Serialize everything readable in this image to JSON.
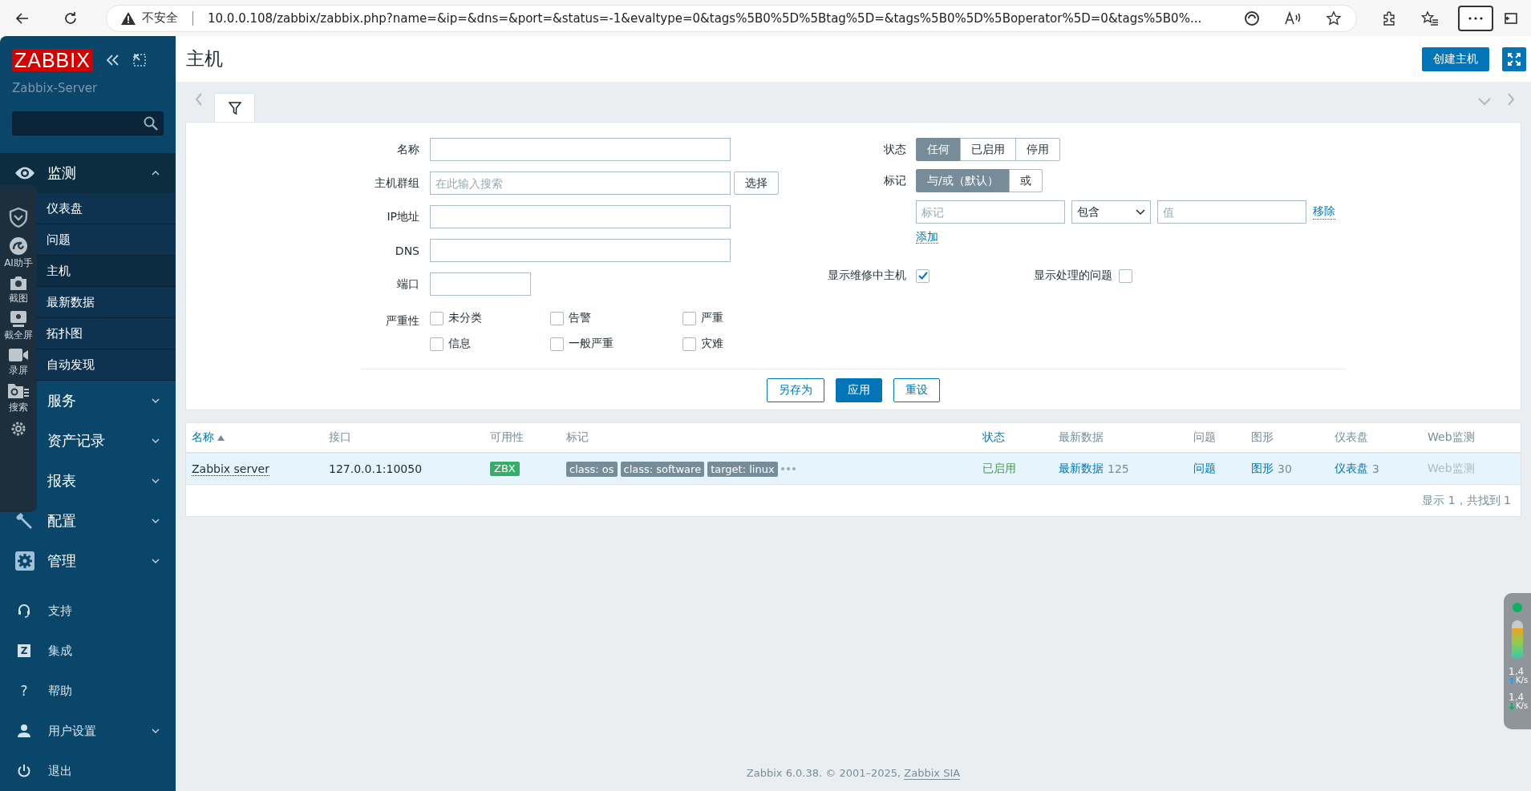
{
  "browser": {
    "security": "不安全",
    "url": "10.0.0.108/zabbix/zabbix.php?name=&ip=&dns=&port=&status=-1&evaltype=0&tags%5B0%5D%5Btag%5D=&tags%5B0%5D%5Boperator%5D=0&tags%5B0%..."
  },
  "sidebar": {
    "logo": "ZABBIX",
    "server_name": "Zabbix-Server",
    "menu": [
      {
        "label": "监测",
        "expanded": true,
        "children": [
          {
            "label": "仪表盘",
            "selected": false
          },
          {
            "label": "问题",
            "selected": false
          },
          {
            "label": "主机",
            "selected": true
          },
          {
            "label": "最新数据",
            "selected": false
          },
          {
            "label": "拓扑图",
            "selected": false
          },
          {
            "label": "自动发现",
            "selected": false
          }
        ]
      },
      {
        "label": "服务",
        "expanded": false
      },
      {
        "label": "资产记录",
        "expanded": false
      },
      {
        "label": "报表",
        "expanded": false
      },
      {
        "label": "配置",
        "expanded": false
      },
      {
        "label": "管理",
        "expanded": false
      }
    ],
    "bottom_menu": [
      {
        "label": "支持",
        "has_submenu": false
      },
      {
        "label": "集成",
        "glyph": "Z",
        "has_submenu": false
      },
      {
        "label": "帮助",
        "glyph": "?",
        "has_submenu": false
      },
      {
        "label": "用户设置",
        "has_submenu": true
      },
      {
        "label": "退出",
        "has_submenu": false
      }
    ]
  },
  "capture_toolbar": {
    "items": [
      {
        "label": "AI助手"
      },
      {
        "label": "截图"
      },
      {
        "label": "截全屏"
      },
      {
        "label": "录屏"
      },
      {
        "label": "搜索"
      }
    ]
  },
  "header": {
    "title": "主机",
    "create_button": "创建主机"
  },
  "filter": {
    "fields": [
      {
        "label": "名称",
        "kind": "text"
      },
      {
        "label": "主机群组",
        "kind": "multiselect",
        "placeholder": "在此输入搜索",
        "button": "选择"
      },
      {
        "label": "IP地址",
        "kind": "text"
      },
      {
        "label": "DNS",
        "kind": "text"
      },
      {
        "label": "端口",
        "kind": "short"
      }
    ],
    "severity": {
      "label": "严重性",
      "options": [
        {
          "label": "未分类",
          "checked": false
        },
        {
          "label": "告警",
          "checked": false
        },
        {
          "label": "严重",
          "checked": false
        },
        {
          "label": "信息",
          "checked": false
        },
        {
          "label": "一般严重",
          "checked": false
        },
        {
          "label": "灾难",
          "checked": false
        }
      ]
    },
    "status": {
      "label": "状态",
      "options": [
        {
          "label": "任何",
          "selected": true
        },
        {
          "label": "已启用",
          "selected": false
        },
        {
          "label": "停用",
          "selected": false
        }
      ]
    },
    "tags": {
      "label": "标记",
      "operators": [
        {
          "label": "与/或（默认）",
          "selected": true
        },
        {
          "label": "或",
          "selected": false
        }
      ],
      "tag_placeholder": "标记",
      "condition": "包含",
      "value_placeholder": "值",
      "remove": "移除",
      "add": "添加"
    },
    "toggles": [
      {
        "label": "显示维修中主机",
        "checked": true
      },
      {
        "label": "显示处理的问题",
        "checked": false
      }
    ],
    "buttons": [
      {
        "label": "另存为",
        "kind": "outline"
      },
      {
        "label": "应用",
        "kind": "primary"
      },
      {
        "label": "重设",
        "kind": "outline"
      }
    ]
  },
  "table": {
    "columns": [
      {
        "label": "名称",
        "sortable": true,
        "sorted": true
      },
      {
        "label": "接口",
        "sortable": false,
        "sorted": false
      },
      {
        "label": "可用性",
        "sortable": false,
        "sorted": false
      },
      {
        "label": "标记",
        "sortable": false,
        "sorted": false
      },
      {
        "label": "状态",
        "sortable": true,
        "sorted": false
      },
      {
        "label": "最新数据",
        "sortable": false,
        "sorted": false
      },
      {
        "label": "问题",
        "sortable": false,
        "sorted": false
      },
      {
        "label": "图形",
        "sortable": false,
        "sorted": false
      },
      {
        "label": "仪表盘",
        "sortable": false,
        "sorted": false
      },
      {
        "label": "Web监测",
        "sortable": false,
        "sorted": false
      }
    ],
    "rows": [
      {
        "name": "Zabbix server",
        "interface": "127.0.0.1:10050",
        "availability": "ZBX",
        "tags": [
          "class: os",
          "class: software",
          "target: linux"
        ],
        "status": "已启用",
        "enabled": true,
        "latest_data": "最新数据",
        "latest_data_count": "125",
        "problems": "问题",
        "graphs": "图形",
        "graphs_count": "30",
        "dashboards": "仪表盘",
        "dashboards_count": "3",
        "web": "Web监测",
        "web_enabled": false
      }
    ],
    "summary": "显示 1，共找到 1"
  },
  "footer": {
    "text": "Zabbix 6.0.38. © 2001–2025, ",
    "link": "Zabbix SIA"
  },
  "net_widget": {
    "upload": "1.4",
    "upload_unit": "K/s",
    "download": "1.4",
    "download_unit": "K/s"
  }
}
